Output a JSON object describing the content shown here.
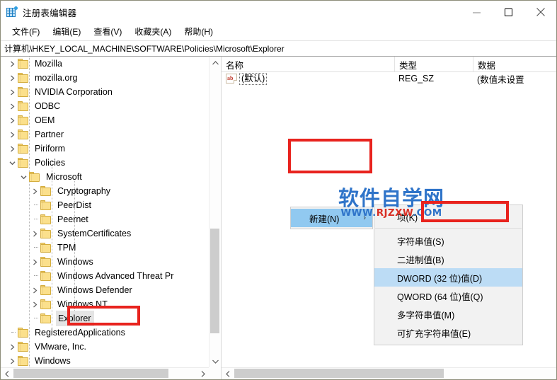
{
  "window": {
    "title": "注册表编辑器",
    "icon": "registry-editor-icon",
    "minimize_label": "–",
    "maximize_label": "□",
    "close_label": "✕"
  },
  "menubar": {
    "items": [
      {
        "label": "文件(F)",
        "name": "menu-file"
      },
      {
        "label": "编辑(E)",
        "name": "menu-edit"
      },
      {
        "label": "查看(V)",
        "name": "menu-view"
      },
      {
        "label": "收藏夹(A)",
        "name": "menu-favorites"
      },
      {
        "label": "帮助(H)",
        "name": "menu-help"
      }
    ]
  },
  "address": {
    "path": "计算机\\HKEY_LOCAL_MACHINE\\SOFTWARE\\Policies\\Microsoft\\Explorer"
  },
  "tree": {
    "nodes": [
      {
        "label": "Mozilla",
        "indent": 1,
        "expander": "collapsed"
      },
      {
        "label": "mozilla.org",
        "indent": 1,
        "expander": "collapsed"
      },
      {
        "label": "NVIDIA Corporation",
        "indent": 1,
        "expander": "collapsed"
      },
      {
        "label": "ODBC",
        "indent": 1,
        "expander": "collapsed"
      },
      {
        "label": "OEM",
        "indent": 1,
        "expander": "collapsed"
      },
      {
        "label": "Partner",
        "indent": 1,
        "expander": "collapsed"
      },
      {
        "label": "Piriform",
        "indent": 1,
        "expander": "collapsed"
      },
      {
        "label": "Policies",
        "indent": 1,
        "expander": "expanded"
      },
      {
        "label": "Microsoft",
        "indent": 2,
        "expander": "expanded"
      },
      {
        "label": "Cryptography",
        "indent": 3,
        "expander": "collapsed"
      },
      {
        "label": "PeerDist",
        "indent": 3,
        "expander": "leaf"
      },
      {
        "label": "Peernet",
        "indent": 3,
        "expander": "leaf"
      },
      {
        "label": "SystemCertificates",
        "indent": 3,
        "expander": "collapsed"
      },
      {
        "label": "TPM",
        "indent": 3,
        "expander": "leaf"
      },
      {
        "label": "Windows",
        "indent": 3,
        "expander": "collapsed"
      },
      {
        "label": "Windows Advanced Threat Pr",
        "indent": 3,
        "expander": "leaf"
      },
      {
        "label": "Windows Defender",
        "indent": 3,
        "expander": "collapsed"
      },
      {
        "label": "Windows NT",
        "indent": 3,
        "expander": "collapsed"
      },
      {
        "label": "Explorer",
        "indent": 3,
        "expander": "leaf",
        "selected": true
      },
      {
        "label": "RegisteredApplications",
        "indent": 1,
        "expander": "leaf"
      },
      {
        "label": "VMware, Inc.",
        "indent": 1,
        "expander": "collapsed"
      },
      {
        "label": "Windows",
        "indent": 1,
        "expander": "collapsed"
      }
    ]
  },
  "list": {
    "columns": [
      {
        "label": "名称",
        "name": "column-name"
      },
      {
        "label": "类型",
        "name": "column-type"
      },
      {
        "label": "数据",
        "name": "column-data"
      }
    ],
    "rows": [
      {
        "icon": "string-value-icon",
        "name": "(默认)",
        "type": "REG_SZ",
        "data": "(数值未设置"
      }
    ]
  },
  "context_menu": {
    "parent": {
      "label": "新建(N)",
      "submenu_arrow": "›",
      "highlighted": true
    },
    "submenu": [
      {
        "label": "项(K)",
        "name": "ctx-new-key",
        "highlighted": false
      },
      {
        "label": "字符串值(S)",
        "name": "ctx-new-string",
        "highlighted": false
      },
      {
        "label": "二进制值(B)",
        "name": "ctx-new-binary",
        "highlighted": false
      },
      {
        "label": "DWORD (32 位)值(D)",
        "name": "ctx-new-dword",
        "highlighted": true
      },
      {
        "label": "QWORD (64 位)值(Q)",
        "name": "ctx-new-qword",
        "highlighted": false
      },
      {
        "label": "多字符串值(M)",
        "name": "ctx-new-multistring",
        "highlighted": false
      },
      {
        "label": "可扩充字符串值(E)",
        "name": "ctx-new-expandstring",
        "highlighted": false
      }
    ]
  },
  "watermark": {
    "main": "软件自学网",
    "sub_prefix": "WWW.",
    "sub_middle": "RJZXW",
    "sub_suffix": ".COM"
  },
  "annotations": {
    "box_color": "#e8231e",
    "boxes": [
      {
        "name": "highlight-new-menu",
        "target": "新建(N)"
      },
      {
        "name": "highlight-dword-item",
        "target": "DWORD (32 位)值(D)"
      },
      {
        "name": "highlight-explorer-node",
        "target": "Explorer"
      }
    ]
  },
  "colors": {
    "selection_blue": "#91c9f0",
    "submenu_highlight": "#bcdcf5",
    "folder_yellow": "#fbe08c",
    "watermark_blue": "#2f74c9",
    "annotation_red": "#e8231e"
  }
}
